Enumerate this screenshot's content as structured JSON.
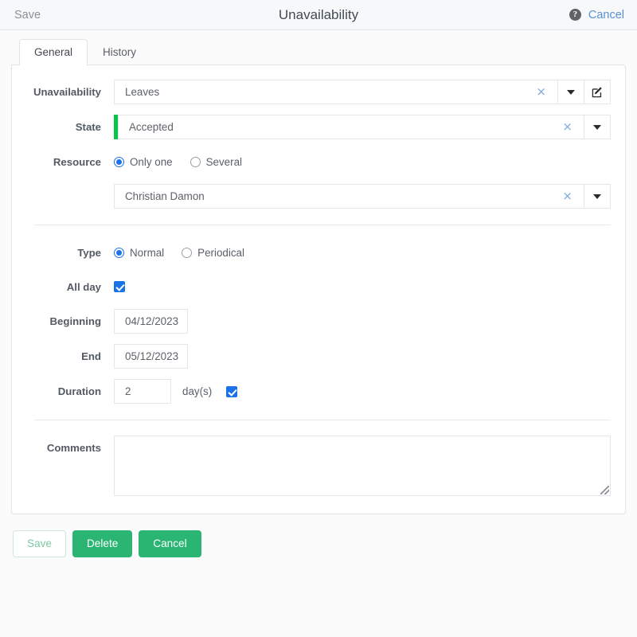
{
  "topbar": {
    "save_label": "Save",
    "title": "Unavailability",
    "help_icon": "help-circle-icon",
    "cancel_label": "Cancel"
  },
  "tabs": [
    {
      "label": "General",
      "active": true
    },
    {
      "label": "History",
      "active": false
    }
  ],
  "form": {
    "unavailability": {
      "label": "Unavailability",
      "value": "Leaves",
      "clear_icon": "×",
      "dropdown_icon": "chevron-down-icon",
      "edit_icon": "edit-pencil-icon"
    },
    "state": {
      "label": "State",
      "value": "Accepted",
      "accent_color": "#0ac44a",
      "clear_icon": "×",
      "dropdown_icon": "chevron-down-icon"
    },
    "resource": {
      "label": "Resource",
      "options": [
        {
          "label": "Only one",
          "selected": true
        },
        {
          "label": "Several",
          "selected": false
        }
      ],
      "value": "Christian Damon",
      "clear_icon": "×",
      "dropdown_icon": "chevron-down-icon"
    },
    "type": {
      "label": "Type",
      "options": [
        {
          "label": "Normal",
          "selected": true
        },
        {
          "label": "Periodical",
          "selected": false
        }
      ]
    },
    "all_day": {
      "label": "All day",
      "checked": true
    },
    "beginning": {
      "label": "Beginning",
      "value": "04/12/2023"
    },
    "end": {
      "label": "End",
      "value": "05/12/2023"
    },
    "duration": {
      "label": "Duration",
      "value": "2",
      "unit": "day(s)",
      "checked": true
    },
    "comments": {
      "label": "Comments",
      "value": "",
      "placeholder": ""
    }
  },
  "footer": {
    "save_label": "Save",
    "delete_label": "Delete",
    "cancel_label": "Cancel"
  },
  "colors": {
    "accent_green": "#2ab573",
    "state_green": "#0ac44a",
    "blue": "#1a73e8",
    "link_blue": "#5b8fd4"
  }
}
